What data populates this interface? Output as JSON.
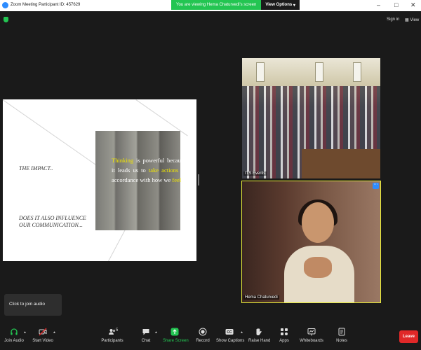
{
  "window": {
    "title": "Zoom Meeting Participant ID: 457629",
    "viewing_message": "You are viewing Hema Chaturvedi's screen",
    "view_options": "View Options",
    "sign_in": "Sign in",
    "view": "View"
  },
  "slide": {
    "title_left": "THE IMPACT..",
    "question_line1": "DOES IT ALSO INFLUENCE",
    "question_line2": "OUR COMMUNICATION...",
    "quote_w1": "Thinking",
    "quote_r1": " is powerful because it leads us to ",
    "quote_w2": "take actions",
    "quote_r2": " in accordance with how we ",
    "quote_w3": "feel",
    "quote_r3": "."
  },
  "videos": [
    {
      "name": "ITS Events"
    },
    {
      "name": "Hema Chaturvedi"
    }
  ],
  "tooltip": "Click to join audio",
  "toolbar": {
    "join_audio": "Join Audio",
    "start_video": "Start Video",
    "participants": "Participants",
    "participants_count": "5",
    "chat": "Chat",
    "share_screen": "Share Screen",
    "record": "Record",
    "show_captions": "Show Captions",
    "raise_hand": "Raise Hand",
    "apps": "Apps",
    "whiteboards": "Whiteboards",
    "notes": "Notes",
    "leave": "Leave",
    "captions_icon_text": "CC"
  },
  "icons": [
    "zoom-app-icon",
    "security-shield-icon",
    "minimize-icon",
    "maximize-icon",
    "close-icon",
    "headphones-icon",
    "video-off-icon",
    "participants-icon",
    "chat-icon",
    "share-screen-icon",
    "record-icon",
    "captions-icon",
    "raise-hand-icon",
    "apps-icon",
    "whiteboards-icon",
    "notes-icon",
    "more-options-icon"
  ],
  "colors": {
    "viewing_banner": "#23c552",
    "active_speaker_border": "#e8ec3a",
    "leave": "#e02828",
    "highlight": "#f2e600"
  }
}
